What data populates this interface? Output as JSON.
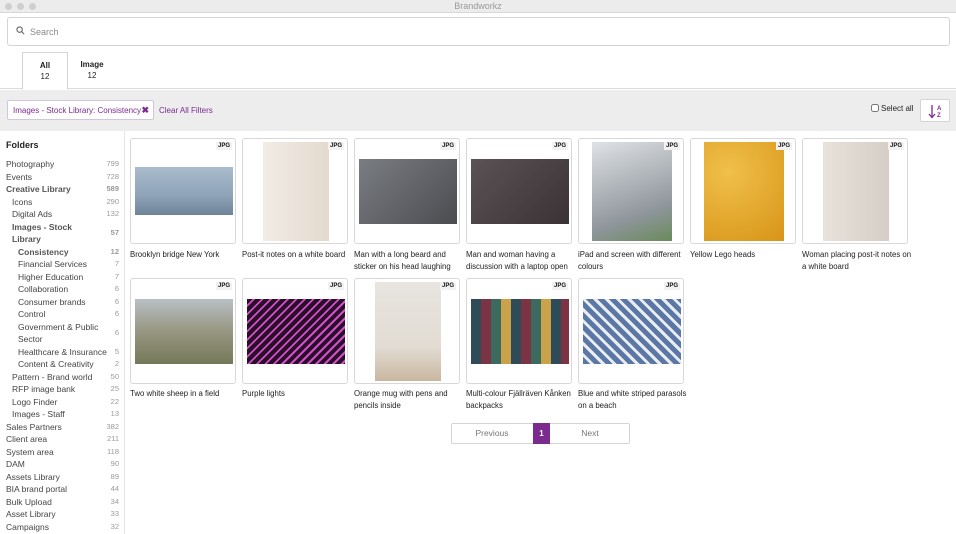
{
  "window": {
    "title": "Brandworkz"
  },
  "search": {
    "placeholder": "Search",
    "value": ""
  },
  "tabs": [
    {
      "label": "All",
      "count": "12",
      "active": true
    },
    {
      "label": "Image",
      "count": "12",
      "active": false
    }
  ],
  "filters": {
    "active_filter": "Images - Stock Library: Consistency",
    "clear_label": "Clear All Filters",
    "select_all_label": "Select all"
  },
  "sidebar": {
    "title": "Folders",
    "items": [
      {
        "label": "Photography",
        "count": "799"
      },
      {
        "label": "Events",
        "count": "728"
      },
      {
        "label": "Creative Library",
        "count": "589"
      },
      {
        "label": "Icons",
        "count": "290"
      },
      {
        "label": "Digital Ads",
        "count": "132"
      },
      {
        "label": "Images - Stock Library",
        "count": "57"
      },
      {
        "label": "Consistency",
        "count": "12"
      },
      {
        "label": "Financial Services",
        "count": "7"
      },
      {
        "label": "Higher Education",
        "count": "7"
      },
      {
        "label": "Collaboration",
        "count": "6"
      },
      {
        "label": "Consumer brands",
        "count": "6"
      },
      {
        "label": "Control",
        "count": "6"
      },
      {
        "label": "Government & Public Sector",
        "count": "6"
      },
      {
        "label": "Healthcare & Insurance",
        "count": "5"
      },
      {
        "label": "Content & Creativity",
        "count": "2"
      },
      {
        "label": "Pattern - Brand world",
        "count": "50"
      },
      {
        "label": "RFP image bank",
        "count": "25"
      },
      {
        "label": "Logo Finder",
        "count": "22"
      },
      {
        "label": "Images - Staff",
        "count": "13"
      },
      {
        "label": "Sales Partners",
        "count": "382"
      },
      {
        "label": "Client area",
        "count": "211"
      },
      {
        "label": "System area",
        "count": "118"
      },
      {
        "label": "DAM",
        "count": "90"
      },
      {
        "label": "Assets Library",
        "count": "89"
      },
      {
        "label": "BIA brand portal",
        "count": "44"
      },
      {
        "label": "Bulk Upload",
        "count": "34"
      },
      {
        "label": "Asset Library",
        "count": "33"
      },
      {
        "label": "Campaigns",
        "count": "32"
      }
    ]
  },
  "assets": [
    {
      "title": "Brooklyn bridge New York",
      "type": "JPG",
      "color": "#8ea3b8"
    },
    {
      "title": "Post-it notes on a white board",
      "type": "JPG",
      "color": "#ece4dc"
    },
    {
      "title": "Man with a long beard and sticker on his head laughing",
      "type": "JPG",
      "color": "#5a5c60"
    },
    {
      "title": "Man and woman having a discussion with a laptop open",
      "type": "JPG",
      "color": "#4a4244"
    },
    {
      "title": "iPad and screen with different colours",
      "type": "JPG",
      "color": "#9aa0a6"
    },
    {
      "title": "Yellow Lego heads",
      "type": "JPG",
      "color": "#e6a623"
    },
    {
      "title": "Woman placing post-it notes on a white board",
      "type": "JPG",
      "color": "#dcd6cf"
    },
    {
      "title": "Two white sheep in a field",
      "type": "JPG",
      "color": "#8b8c6c"
    },
    {
      "title": "Purple lights",
      "type": "JPG",
      "color": "#7a2a72"
    },
    {
      "title": "Orange mug with pens and pencils inside",
      "type": "JPG",
      "color": "#d9cdbf"
    },
    {
      "title": "Multi-colour Fjällräven Kånken backpacks",
      "type": "JPG",
      "color": "#3a5560"
    },
    {
      "title": "Blue and white striped parasols on a beach",
      "type": "JPG",
      "color": "#6a84ad"
    }
  ],
  "pagination": {
    "previous": "Previous",
    "current": "1",
    "next": "Next"
  }
}
